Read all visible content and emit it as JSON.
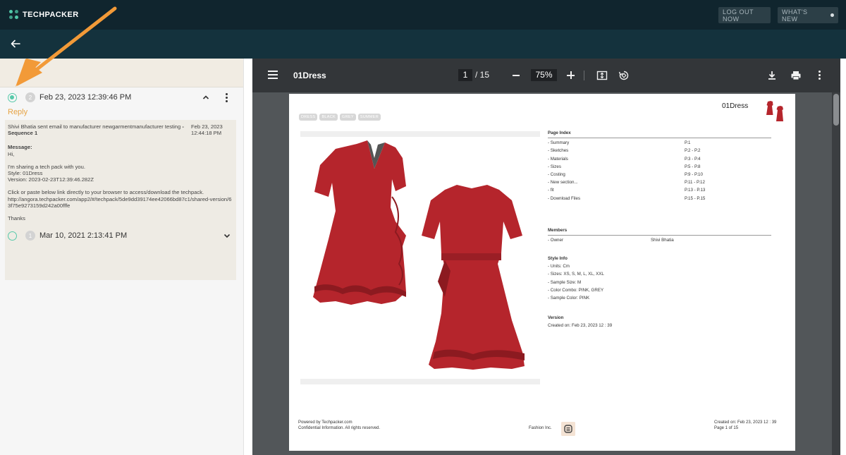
{
  "app": {
    "brand": "TECHPACKER",
    "logout_label": "LOG OUT NOW",
    "whats_new_label": "WHAT'S NEW"
  },
  "history": {
    "items": [
      {
        "number": "2",
        "date": "Feb 23, 2023 12:39:46 PM",
        "selected": true,
        "expanded": true,
        "reply_label": "Reply",
        "message": {
          "header": "Shivi Bhatia sent email to manufacturer newgarmentmanufacturer testing",
          "header_sequence": "- Sequence 1",
          "sent_date": "Feb 23, 2023",
          "sent_time": "12:44:18 PM",
          "label": "Message:",
          "greeting": "Hi,",
          "line1": "I'm sharing a tech pack with you.",
          "style": "Style: 01Dress",
          "version": "Version: 2023-02-23T12:39:46.282Z",
          "instruction": "Click or paste below link directly to your browser to access/download the techpack.",
          "link": "http://angora.techpacker.com/app2/#/techpack/5de9dd39174ee42066bd87c1/shared-version/63f75e9273159d242a00fffe",
          "signoff": "Thanks"
        }
      },
      {
        "number": "1",
        "date": "Mar 10, 2021 2:13:41 PM",
        "selected": false,
        "expanded": false
      }
    ]
  },
  "viewer": {
    "doc_title": "01Dress",
    "current_page": "1",
    "total_pages": "/ 15",
    "zoom": "75%"
  },
  "document": {
    "title": "01Dress",
    "tags": [
      "DRESS",
      "BLACK",
      "GREY",
      "SUMMER"
    ],
    "page_index_title": "Page Index",
    "page_index": [
      {
        "name": "- Summary",
        "pages": "P.1"
      },
      {
        "name": "- Sketches",
        "pages": "P.2 - P.2"
      },
      {
        "name": "- Materials",
        "pages": "P.3 - P.4"
      },
      {
        "name": "- Sizes",
        "pages": "P.5 - P.8"
      },
      {
        "name": "- Costing",
        "pages": "P.9 - P.10"
      },
      {
        "name": "- New section...",
        "pages": "P.11 - P.12"
      },
      {
        "name": "- fit",
        "pages": "P.13 - P.13"
      },
      {
        "name": "- Download Files",
        "pages": "P.15 - P.15"
      }
    ],
    "members_title": "Members",
    "members": [
      {
        "role": "- Owner",
        "name": "Shivi Bhatia"
      }
    ],
    "style_info_title": "Style Info",
    "style_info": [
      "- Units: Cm",
      "- Sizes: XS, S, M, L, XL, XXL",
      "- Sample Size: M",
      "- Color Combo: PINK, GREY",
      "- Sample Color: PINK"
    ],
    "version_title": "Version",
    "version_created": "Created on: Feb 23, 2023 12 : 39",
    "footer": {
      "powered": "Powered by Techpacker.com",
      "confidential": "Confidential Information. All rights reserved.",
      "company": "Fashion Inc.",
      "created": "Created on: Feb 23, 2023 12 : 39",
      "page": "Page 1 of 15"
    }
  },
  "colors": {
    "topbar": "#10252e",
    "subbar": "#14323d",
    "accent_green": "#57c9aa",
    "reply_orange": "#e6a344",
    "dress_red": "#b5252c",
    "annotation_arrow": "#f29a38"
  },
  "icons": [
    "back-arrow-icon",
    "chevron-up-icon",
    "chevron-down-icon",
    "kebab-menu-icon",
    "hamburger-menu-icon",
    "fit-page-icon",
    "rotate-icon",
    "download-icon",
    "print-icon"
  ]
}
